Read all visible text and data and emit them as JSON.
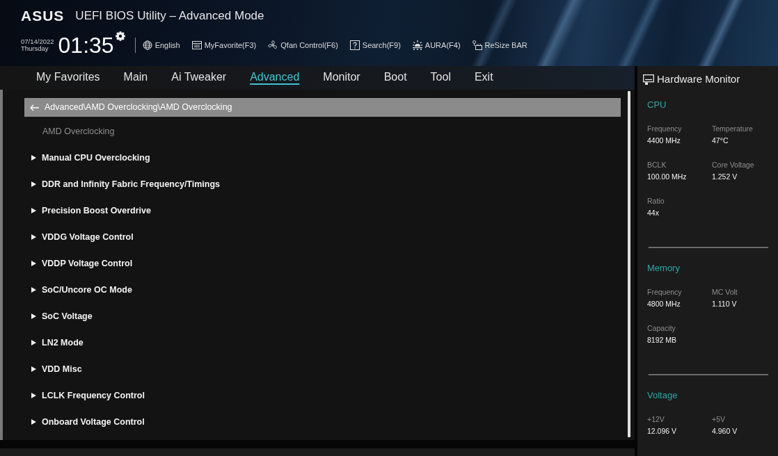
{
  "header": {
    "logo": "ASUS",
    "title": "UEFI BIOS Utility – Advanced Mode",
    "date": "07/14/2022",
    "weekday": "Thursday",
    "time": "01:35",
    "toolbar": [
      {
        "kind": "language",
        "label": "English"
      },
      {
        "kind": "favorite",
        "label": "MyFavorite(F3)"
      },
      {
        "kind": "fan",
        "label": "Qfan Control(F6)"
      },
      {
        "kind": "search",
        "label": "Search(F9)"
      },
      {
        "kind": "aura",
        "label": "AURA(F4)"
      },
      {
        "kind": "resize",
        "label": "ReSize BAR"
      }
    ]
  },
  "tabs": [
    {
      "label": "My Favorites",
      "selected": false
    },
    {
      "label": "Main",
      "selected": false
    },
    {
      "label": "Ai Tweaker",
      "selected": false
    },
    {
      "label": "Advanced",
      "selected": true
    },
    {
      "label": "Monitor",
      "selected": false
    },
    {
      "label": "Boot",
      "selected": false
    },
    {
      "label": "Tool",
      "selected": false
    },
    {
      "label": "Exit",
      "selected": false
    }
  ],
  "content": {
    "breadcrumb": "Advanced\\AMD Overclocking\\AMD Overclocking",
    "heading": "AMD Overclocking",
    "items": [
      {
        "label": "Manual CPU Overclocking"
      },
      {
        "label": "DDR and Infinity Fabric Frequency/Timings"
      },
      {
        "label": "Precision Boost Overdrive"
      },
      {
        "label": "VDDG Voltage Control"
      },
      {
        "label": "VDDP Voltage Control"
      },
      {
        "label": "SoC/Uncore OC Mode"
      },
      {
        "label": "SoC Voltage"
      },
      {
        "label": "LN2 Mode"
      },
      {
        "label": "VDD Misc"
      },
      {
        "label": "LCLK Frequency Control"
      },
      {
        "label": "Onboard Voltage Control"
      }
    ]
  },
  "hardware_monitor": {
    "title": "Hardware Monitor",
    "sections": [
      {
        "title": "CPU",
        "readings": [
          {
            "label": "Frequency",
            "value": "4400 MHz"
          },
          {
            "label": "Temperature",
            "value": "47°C"
          },
          {
            "label": "BCLK",
            "value": "100.00 MHz"
          },
          {
            "label": "Core Voltage",
            "value": "1.252 V"
          },
          {
            "label": "Ratio",
            "value": "44x"
          }
        ]
      },
      {
        "title": "Memory",
        "readings": [
          {
            "label": "Frequency",
            "value": "4800 MHz"
          },
          {
            "label": "MC Volt",
            "value": "1.110 V"
          },
          {
            "label": "Capacity",
            "value": "8192 MB"
          }
        ]
      },
      {
        "title": "Voltage",
        "readings": [
          {
            "label": "+12V",
            "value": "12.096 V"
          },
          {
            "label": "+5V",
            "value": "4.960 V"
          }
        ]
      }
    ]
  }
}
